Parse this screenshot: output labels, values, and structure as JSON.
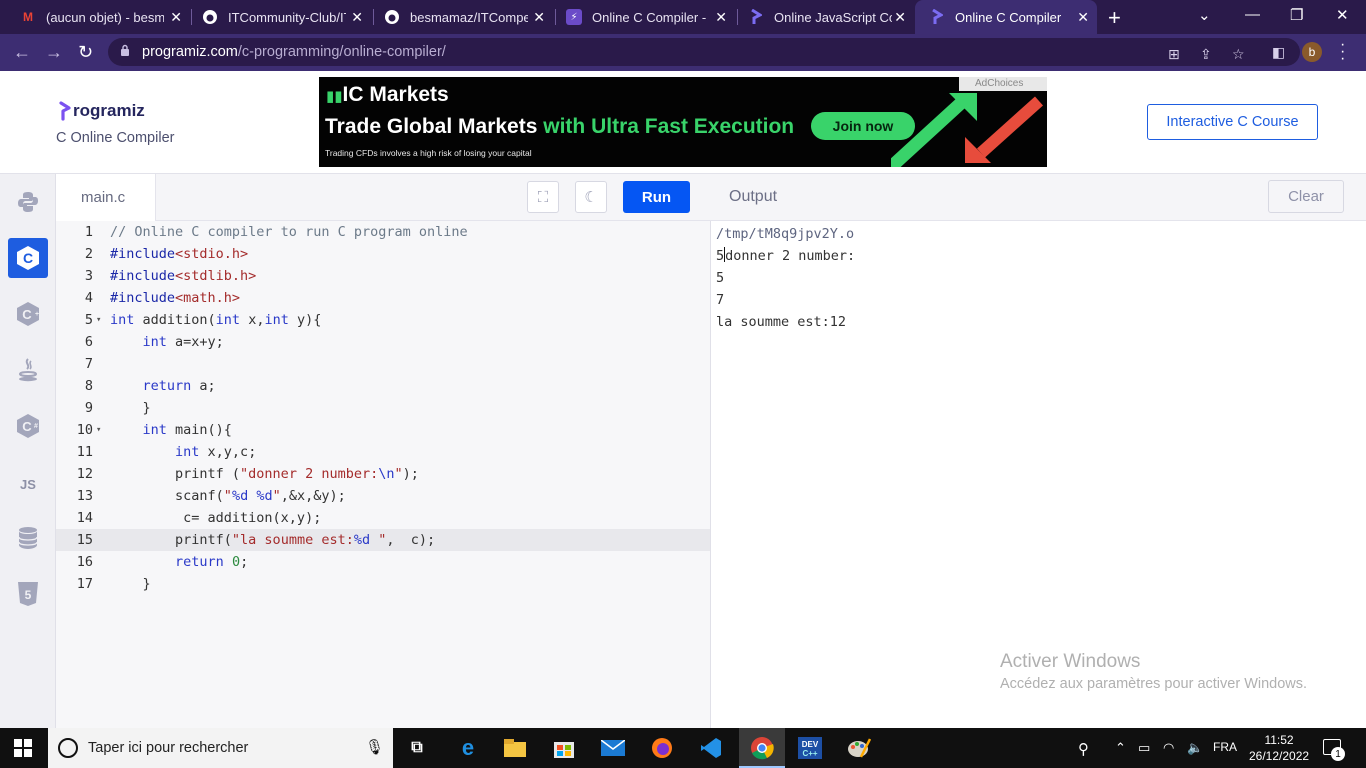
{
  "browser": {
    "tabs": [
      {
        "title": "(aucun objet) - besmaz",
        "favicon": "gmail-icon"
      },
      {
        "title": "ITCommunity-Club/ITC",
        "favicon": "github-icon"
      },
      {
        "title": "besmamaz/ITCompetiti",
        "favicon": "github-icon"
      },
      {
        "title": "Online C Compiler - o",
        "favicon": "replit-icon"
      },
      {
        "title": "Online JavaScript Com",
        "favicon": "programiz-icon"
      },
      {
        "title": "Online C Compiler",
        "favicon": "programiz-icon",
        "active": true
      }
    ],
    "url_host": "programiz.com",
    "url_path": "/c-programming/online-compiler/",
    "profile_initial": "b"
  },
  "header": {
    "logo_text": "rogramiz",
    "subtitle": "C Online Compiler",
    "course_button": "Interactive C Course"
  },
  "ad": {
    "brand": "IC Markets",
    "headline_white": "Trade Global Markets",
    "headline_green": "with Ultra Fast Execution",
    "cta": "Join now",
    "disclaimer": "Trading CFDs involves a high risk of losing your capital",
    "adchoices": "AdChoices"
  },
  "sidebar": {
    "languages": [
      "python",
      "c",
      "cpp",
      "java",
      "csharp",
      "javascript",
      "sql",
      "html"
    ],
    "active": "c",
    "js_label": "JS"
  },
  "editor": {
    "filename": "main.c",
    "run_label": "Run",
    "active_line": 15,
    "lines": [
      "// Online C compiler to run C program online",
      "#include<stdio.h>",
      "#include<stdlib.h>",
      "#include<math.h>",
      "int addition(int x,int y){",
      "    int a=x+y;",
      "",
      "    return a;",
      "    }",
      "    int main(){",
      "        int x,y,c;",
      "        printf (\"donner 2 number:\\n\");",
      "        scanf(\"%d %d\",&x,&y);",
      "         c= addition(x,y);",
      "        printf(\"la soumme est:%d \",  c);",
      "        return 0;",
      "    }"
    ]
  },
  "output": {
    "title": "Output",
    "clear_label": "Clear",
    "lines": [
      "/tmp/tM8q9jpv2Y.o",
      "5donner 2 number:",
      "5",
      "7",
      "la soumme est:12"
    ]
  },
  "watermark": {
    "line1": "Activer Windows",
    "line2": "Accédez aux paramètres pour activer Windows."
  },
  "taskbar": {
    "search_placeholder": "Taper ici pour rechercher",
    "language": "FRA",
    "time": "11:52",
    "date": "26/12/2022",
    "notification_count": "1"
  }
}
